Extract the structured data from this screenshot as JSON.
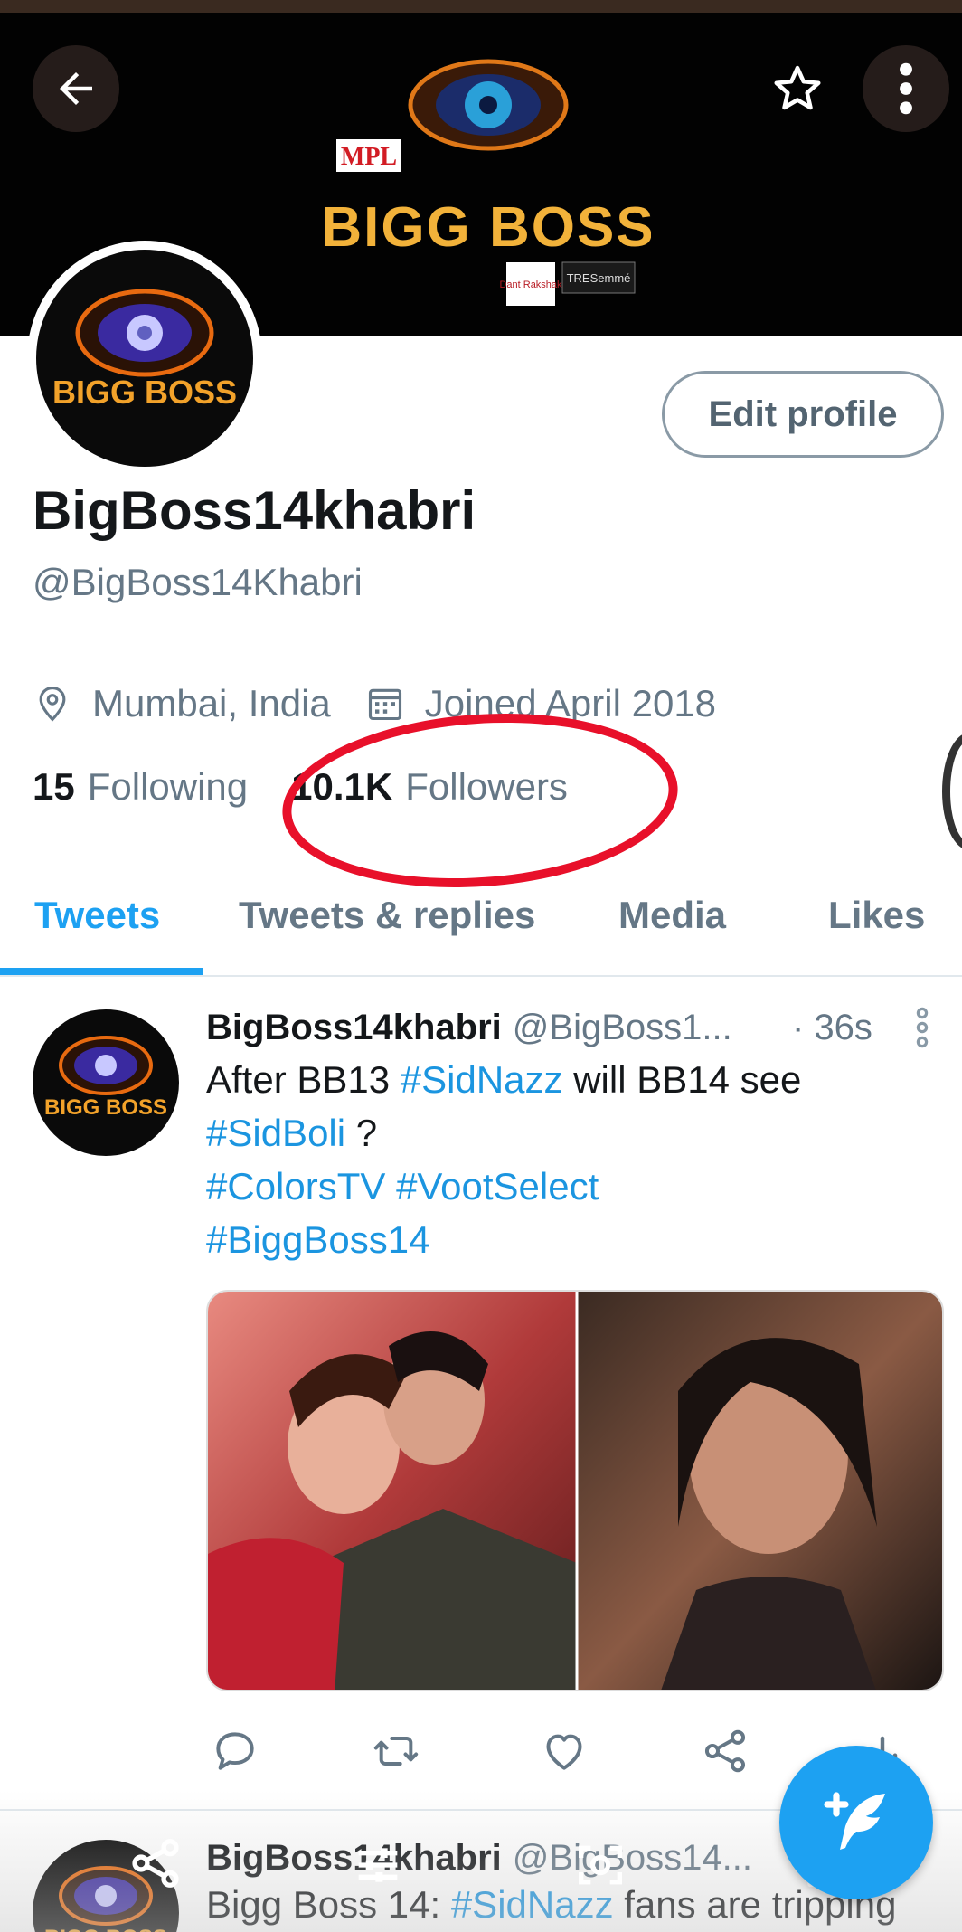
{
  "banner": {
    "logo_lines": [
      "MPL",
      "BIGG BOSS"
    ],
    "sponsors": [
      "Dant Rakshak",
      "TRESemmé"
    ]
  },
  "profile": {
    "avatar_text": "BIGG BOSS",
    "edit_label": "Edit profile",
    "name": "BigBoss14khabri",
    "handle": "@BigBoss14Khabri",
    "location": "Mumbai, India",
    "joined": "Joined April 2018",
    "following_count": "15",
    "following_label": "Following",
    "followers_count": "10.1K",
    "followers_label": "Followers"
  },
  "tabs": [
    "Tweets",
    "Tweets & replies",
    "Media",
    "Likes"
  ],
  "tweet1": {
    "name": "BigBoss14khabri",
    "handle": "@BigBoss1...",
    "time": "· 36s",
    "line1_pre": "After BB13 ",
    "line1_tag": "#SidNazz",
    "line1_post": " will BB14 see",
    "line2_tag": "#SidBoli",
    "line2_post": " ?",
    "line3_tag1": "#ColorsTV",
    "line3_tag2": "#VootSelect",
    "line4_tag": "#BiggBoss14"
  },
  "tweet2": {
    "name": "BigBoss14khabri",
    "handle": "@BigBoss14...",
    "text_pre": "Bigg Boss 14: ",
    "text_tag": "#SidNazz",
    "text_post": " fans are tripping"
  },
  "colors": {
    "accent": "#1da1f2",
    "annotation": "#e8102a"
  }
}
